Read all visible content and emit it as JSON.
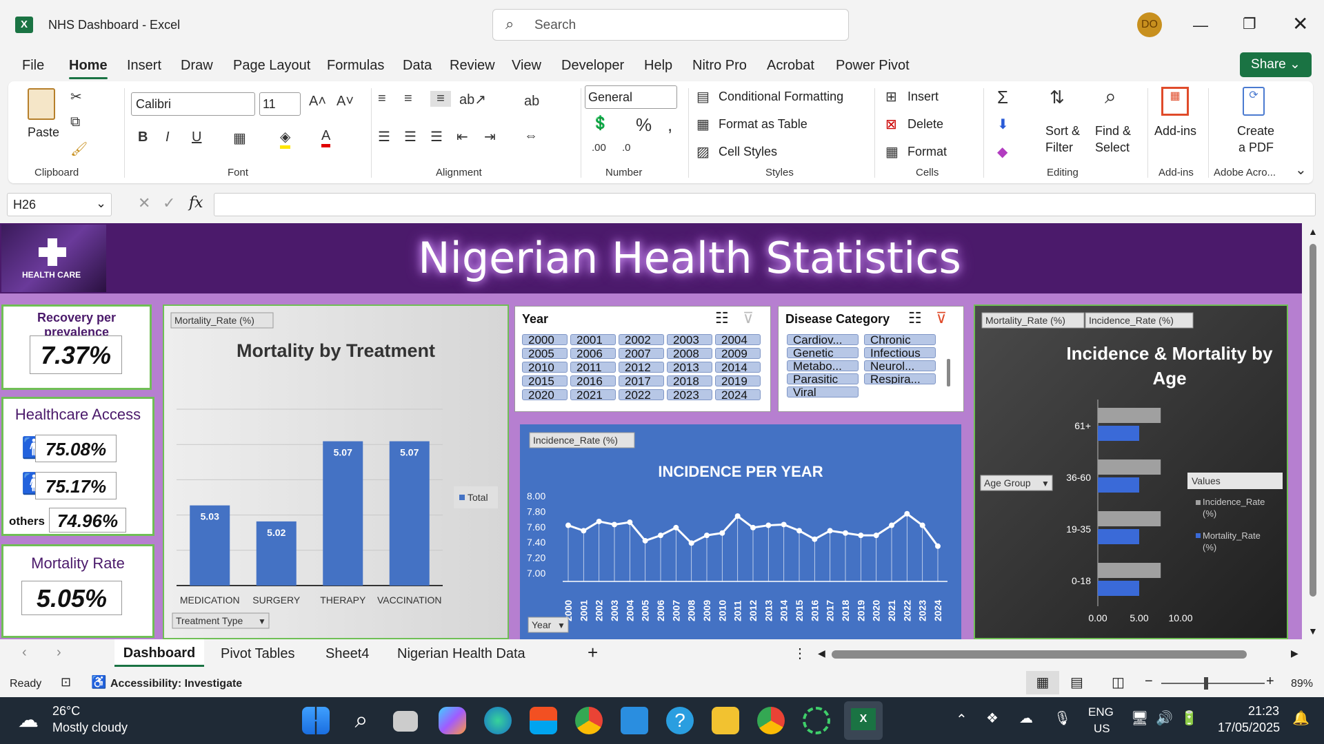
{
  "titlebar": {
    "app_title": "NHS Dashboard  -  Excel",
    "search_placeholder": "Search",
    "avatar": "DO"
  },
  "menu": [
    "File",
    "Home",
    "Insert",
    "Draw",
    "Page Layout",
    "Formulas",
    "Data",
    "Review",
    "View",
    "Developer",
    "Help",
    "Nitro Pro",
    "Acrobat",
    "Power Pivot"
  ],
  "share_label": "Share",
  "ribbon": {
    "paste": "Paste",
    "clipboard": "Clipboard",
    "font_name": "Calibri",
    "font_size": "11",
    "font": "Font",
    "alignment": "Alignment",
    "number_format": "General",
    "number": "Number",
    "cond_format": "Conditional Formatting",
    "format_table": "Format as Table",
    "cell_styles": "Cell Styles",
    "styles": "Styles",
    "insert": "Insert",
    "delete": "Delete",
    "format": "Format",
    "cells": "Cells",
    "sort1": "Sort &",
    "sort2": "Filter",
    "find1": "Find &",
    "find2": "Select",
    "editing": "Editing",
    "addins": "Add-ins",
    "addins_grp": "Add-ins",
    "pdf1": "Create",
    "pdf2": "a PDF",
    "adobe": "Adobe Acro..."
  },
  "formula": {
    "namebox": "H26",
    "fx": "fx",
    "value": ""
  },
  "dashboard": {
    "title": "Nigerian Health Statistics",
    "logo_text": "HEALTH CARE",
    "recovery": {
      "title": "Recovery per prevalence",
      "value": "7.37%"
    },
    "access": {
      "title": "Healthcare Access",
      "male": "75.08%",
      "female": "75.17%",
      "others_label": "others",
      "others": "74.96%"
    },
    "mortality": {
      "title": "Mortality Rate",
      "value": "5.05%"
    },
    "year_slicer": {
      "title": "Year",
      "items": [
        "2000",
        "2001",
        "2002",
        "2003",
        "2004",
        "2005",
        "2006",
        "2007",
        "2008",
        "2009",
        "2010",
        "2011",
        "2012",
        "2013",
        "2014",
        "2015",
        "2016",
        "2017",
        "2018",
        "2019",
        "2020",
        "2021",
        "2022",
        "2023",
        "2024"
      ]
    },
    "disease_slicer": {
      "title": "Disease Category",
      "items": [
        "Cardiov...",
        "Chronic",
        "Genetic",
        "Infectious",
        "Metabo...",
        "Neurol...",
        "Parasitic",
        "Respira...",
        "Viral"
      ]
    }
  },
  "colors": {
    "accent": "#1a7343",
    "purple": "#4b1a6b",
    "lavender": "#b67fd0",
    "bar": "#4472c4",
    "panel_blue": "#4472c4",
    "dark_panel": "#2f2f2f"
  },
  "chart_data": [
    {
      "type": "bar",
      "title": "Mortality by Treatment",
      "field_button": "Mortality_Rate (%)",
      "filter_button": "Treatment Type",
      "legend": [
        "Total"
      ],
      "categories": [
        "MEDICATION",
        "SURGERY",
        "THERAPY",
        "VACCINATION"
      ],
      "values": [
        5.03,
        5.02,
        5.07,
        5.07
      ],
      "ylim": [
        4.98,
        5.09
      ]
    },
    {
      "type": "line",
      "title": "INCIDENCE PER YEAR",
      "field_button": "Incidence_Rate (%)",
      "filter_button": "Year",
      "x": [
        "2000",
        "2001",
        "2002",
        "2003",
        "2004",
        "2005",
        "2006",
        "2007",
        "2008",
        "2009",
        "2010",
        "2011",
        "2012",
        "2013",
        "2014",
        "2015",
        "2016",
        "2017",
        "2018",
        "2019",
        "2020",
        "2021",
        "2022",
        "2023",
        "2024"
      ],
      "values": [
        7.62,
        7.55,
        7.67,
        7.63,
        7.66,
        7.42,
        7.49,
        7.59,
        7.39,
        7.49,
        7.52,
        7.74,
        7.59,
        7.62,
        7.63,
        7.55,
        7.44,
        7.55,
        7.52,
        7.49,
        7.49,
        7.62,
        7.77,
        7.62,
        7.35
      ],
      "yticks": [
        "8.00",
        "7.80",
        "7.60",
        "7.40",
        "7.20",
        "7.00"
      ],
      "ylim": [
        7.0,
        8.0
      ]
    },
    {
      "type": "bar",
      "title": "Incidence & Mortality by Age",
      "field_buttons": [
        "Mortality_Rate (%)",
        "Incidence_Rate (%)"
      ],
      "filter_button": "Age Group",
      "legend_title": "Values",
      "categories": [
        "61+",
        "36-60",
        "19-35",
        "0-18"
      ],
      "series": [
        {
          "name": "Incidence_Rate (%)",
          "values": [
            7.6,
            7.6,
            7.6,
            7.6
          ]
        },
        {
          "name": "Mortality_Rate (%)",
          "values": [
            5.0,
            5.0,
            5.0,
            5.0
          ]
        }
      ],
      "xticks": [
        "0.00",
        "5.00",
        "10.00"
      ],
      "xlim": [
        0,
        10
      ]
    }
  ],
  "sheet_tabs": [
    "Dashboard",
    "Pivot Tables",
    "Sheet4",
    "Nigerian Health Data"
  ],
  "status": {
    "ready": "Ready",
    "accessibility": "Accessibility: Investigate",
    "zoom": "89%"
  },
  "taskbar": {
    "temp": "26°C",
    "weather": "Mostly cloudy",
    "lang1": "ENG",
    "lang2": "US",
    "time": "21:23",
    "date": "17/05/2025"
  }
}
